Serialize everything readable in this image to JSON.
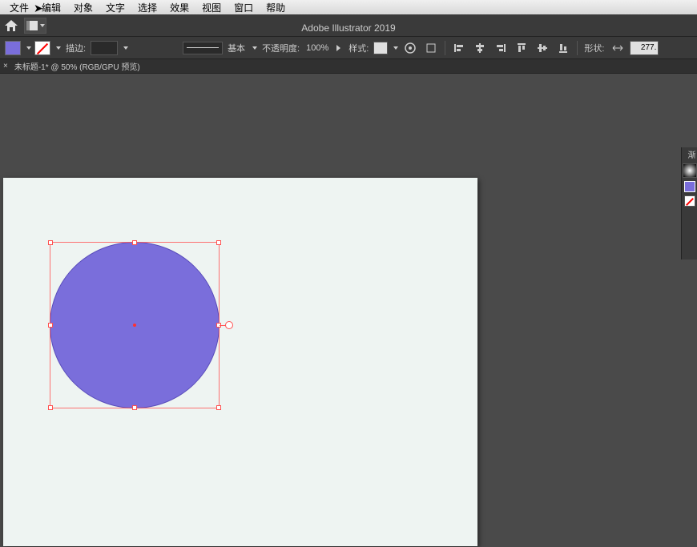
{
  "menubar": {
    "items": [
      "文件",
      "编辑",
      "对象",
      "文字",
      "选择",
      "效果",
      "视图",
      "窗口",
      "帮助"
    ]
  },
  "app": {
    "title": "Adobe Illustrator 2019"
  },
  "toolbar": {
    "stroke_label": "描边:",
    "stroke_weight": "",
    "uniform_label": "基本",
    "opacity_label": "不透明度:",
    "opacity_value": "100%",
    "style_label": "样式:",
    "shape_label": "形状:",
    "shape_value": "277."
  },
  "tab": {
    "title": "未标题-1* @ 50% (RGB/GPU 预览)"
  },
  "side": {
    "label": "渐"
  },
  "colors": {
    "fill": "#7a6edb",
    "artboard": "#eef4f2",
    "selection": "#ff5050"
  }
}
